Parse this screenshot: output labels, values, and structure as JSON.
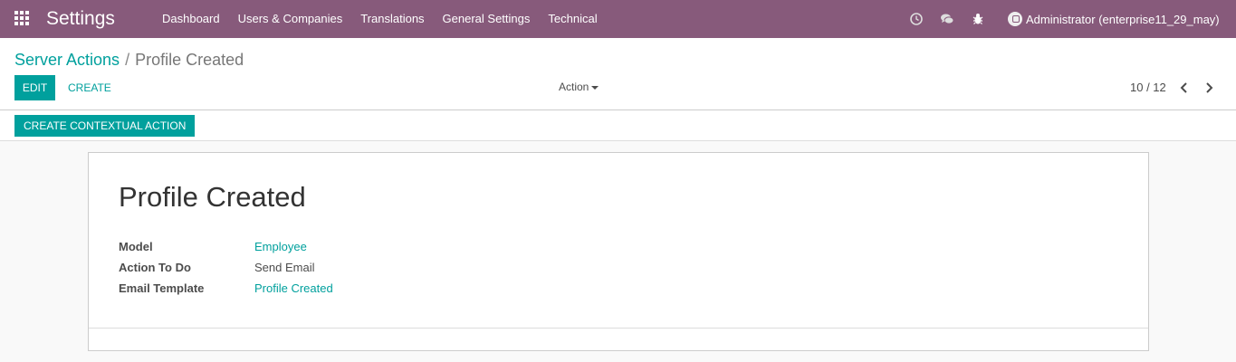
{
  "navbar": {
    "brand": "Settings",
    "menu": [
      "Dashboard",
      "Users & Companies",
      "Translations",
      "General Settings",
      "Technical"
    ],
    "user": "Administrator (enterprise11_29_may)"
  },
  "breadcrumb": {
    "parent": "Server Actions",
    "separator": "/",
    "current": "Profile Created"
  },
  "buttons": {
    "edit": "EDIT",
    "create": "CREATE",
    "action": "Action",
    "contextual": "CREATE CONTEXTUAL ACTION"
  },
  "pager": {
    "value": "10 / 12"
  },
  "record": {
    "title": "Profile Created",
    "fields": [
      {
        "label": "Model",
        "value": "Employee",
        "link": true
      },
      {
        "label": "Action To Do",
        "value": "Send Email",
        "link": false
      },
      {
        "label": "Email Template",
        "value": "Profile Created",
        "link": true
      }
    ]
  },
  "colors": {
    "navbar": "#875a7b",
    "primary": "#00a09d"
  },
  "icons": [
    "apps-grid-icon",
    "clock-icon",
    "chat-icon",
    "bug-icon",
    "chevron-left-icon",
    "chevron-right-icon"
  ]
}
